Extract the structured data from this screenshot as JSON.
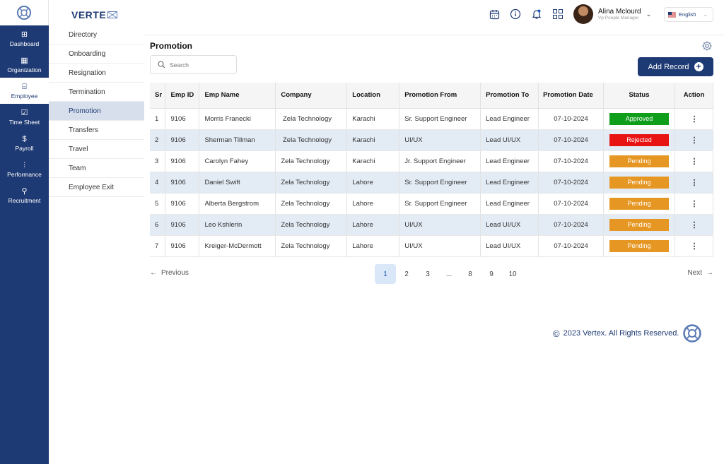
{
  "brand": {
    "name": "VERTE"
  },
  "rail": [
    {
      "label": "Dashboard",
      "icon": "dashboard-icon",
      "glyph": "⊞"
    },
    {
      "label": "Organization",
      "icon": "building-icon",
      "glyph": "▦"
    },
    {
      "label": "Employee",
      "icon": "briefcase-icon",
      "glyph": "⌸"
    },
    {
      "label": "Time Sheet",
      "icon": "checkbox-icon",
      "glyph": "☑"
    },
    {
      "label": "Payroll",
      "icon": "dollar-icon",
      "glyph": "$"
    },
    {
      "label": "Performance",
      "icon": "chart-icon",
      "glyph": "⫶"
    },
    {
      "label": "Recruitment",
      "icon": "search-user-icon",
      "glyph": "⚲"
    }
  ],
  "subnav": [
    "Directory",
    "Onboarding",
    "Resignation",
    "Termination",
    "Promotion",
    "Transfers",
    "Travel",
    "Team",
    "Employee Exit"
  ],
  "user": {
    "name": "Alina Mclourd",
    "role": "Vp People Manager"
  },
  "language": "English",
  "page": {
    "title": "Promotion",
    "search_placeholder": "Search",
    "add_label": "Add Record"
  },
  "table": {
    "headers": [
      "Sr",
      "Emp ID",
      "Emp Name",
      "Company",
      "Location",
      "Promotion From",
      "Promotion To",
      "Promotion Date",
      "Status",
      "Action"
    ],
    "rows": [
      {
        "sr": "1",
        "id": "9106",
        "name": "Morris Franecki",
        "company": " Zela Technology",
        "location": "Karachi",
        "from": "Sr. Support Engineer",
        "to": "Lead Engineer",
        "date": "07-10-2024",
        "status": "Approved",
        "color": "#0f9d1c"
      },
      {
        "sr": "2",
        "id": "9106",
        "name": "Sherman Tillman",
        "company": " Zela Technology",
        "location": "Karachi",
        "from": "UI/UX",
        "to": "Lead UI/UX",
        "date": "07-10-2024",
        "status": "Rejected",
        "color": "#e81313"
      },
      {
        "sr": "3",
        "id": "9106",
        "name": "Carolyn Fahey",
        "company": "Zela Technology",
        "location": "Karachi",
        "from": "Jr. Support Engineer",
        "to": "Lead Engineer",
        "date": "07-10-2024",
        "status": "Pending",
        "color": "#e69622"
      },
      {
        "sr": "4",
        "id": "9106",
        "name": "Daniel Swift",
        "company": "Zela Technology",
        "location": "Lahore",
        "from": "Sr. Support Engineer",
        "to": "Lead Engineer",
        "date": "07-10-2024",
        "status": "Pending",
        "color": "#e69622"
      },
      {
        "sr": "5",
        "id": "9106",
        "name": "Alberta Bergstrom",
        "company": "Zela Technology",
        "location": "Lahore",
        "from": "Sr. Support Engineer",
        "to": "Lead Engineer",
        "date": "07-10-2024",
        "status": "Pending",
        "color": "#e69622"
      },
      {
        "sr": "6",
        "id": "9106",
        "name": "Leo Kshlerin",
        "company": "Zela Technology",
        "location": "Lahore",
        "from": "UI/UX",
        "to": "Lead UI/UX",
        "date": "07-10-2024",
        "status": "Pending",
        "color": "#e69622"
      },
      {
        "sr": "7",
        "id": "9106",
        "name": "Kreiger-McDermott",
        "company": "Zela Technology",
        "location": "Lahore",
        "from": "UI/UX",
        "to": "Lead UI/UX",
        "date": "07-10-2024",
        "status": "Pending",
        "color": "#e69622"
      }
    ]
  },
  "pagination": {
    "prev": "Previous",
    "next": "Next",
    "pages": [
      "1",
      "2",
      "3",
      "...",
      "8",
      "9",
      "10"
    ],
    "current": "1"
  },
  "footer": "2023 Vertex. All Rights Reserved."
}
